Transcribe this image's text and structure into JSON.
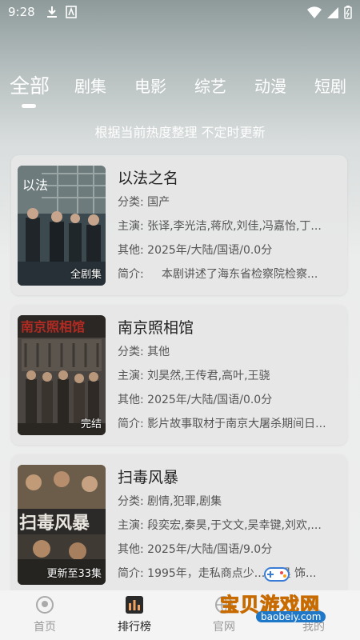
{
  "status_bar": {
    "time": "9:28"
  },
  "tabs": [
    "全部",
    "剧集",
    "电影",
    "综艺",
    "动漫",
    "短剧"
  ],
  "active_tab": "全部",
  "subtitle": "根据当前热度整理 不定时更新",
  "labels": {
    "category": "分类:",
    "cast": "主演:",
    "other": "其他:",
    "intro": "简介:"
  },
  "items": [
    {
      "title": "以法之名",
      "badge": "全剧集",
      "category": "国产",
      "cast": "张译,李光洁,蒋欣,刘佳,冯嘉怡,丁...",
      "other": "2025年/大陆/国语/0.0分",
      "intro": "本剧讲述了海东省检察院检察..."
    },
    {
      "title": "南京照相馆",
      "badge": "完结",
      "category": "其他",
      "cast": "刘昊然,王传君,高叶,王骁",
      "other": "2025年/大陆/国语/0.0分",
      "intro": "影片故事取材于南京大屠杀期间日..."
    },
    {
      "title": "扫毒风暴",
      "badge": "更新至33集",
      "category": "剧情,犯罪,剧集",
      "cast": "段奕宏,秦昊,于文文,吴幸键,刘欢,...",
      "other": "2025年/大陆/国语/9.0分",
      "intro": "1995年，走私商点少... 秦昊 饰..."
    }
  ],
  "bottom_nav": [
    {
      "label": "首页",
      "icon": "home-icon"
    },
    {
      "label": "排行榜",
      "icon": "ranking-icon"
    },
    {
      "label": "官网",
      "icon": "website-icon"
    },
    {
      "label": "我的",
      "icon": "profile-icon"
    }
  ],
  "active_nav": "排行榜",
  "watermark": {
    "text": "宝贝游戏网",
    "url": "baobeiy.com"
  },
  "colors": {
    "accent": "#f7a21b",
    "text": "#222222",
    "secondary": "#555555"
  }
}
